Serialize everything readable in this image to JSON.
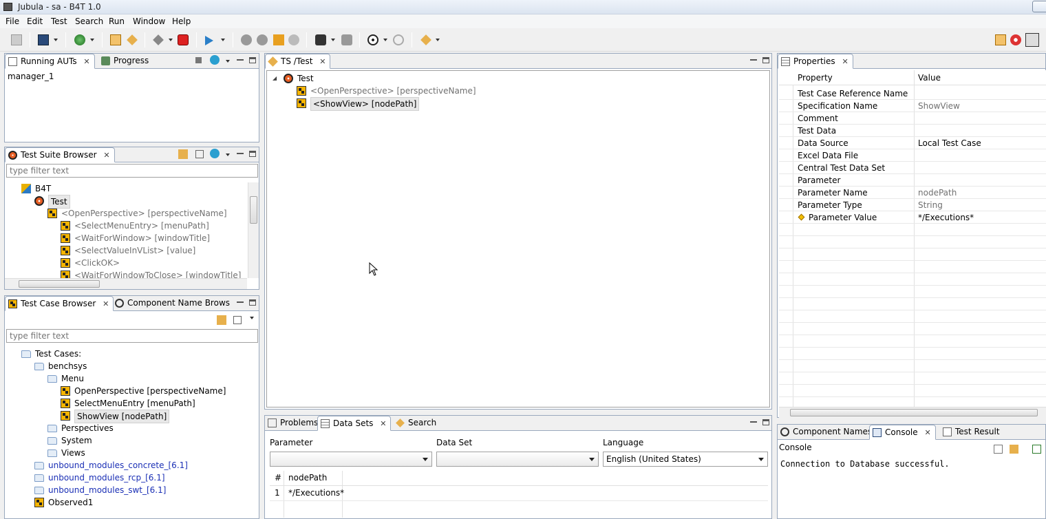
{
  "window": {
    "title": "Jubula - sa - B4T 1.0"
  },
  "menu": [
    "File",
    "Edit",
    "Test",
    "Search",
    "Run",
    "Window",
    "Help"
  ],
  "running_auts": {
    "tabs": [
      {
        "label": "Running AUTs"
      },
      {
        "label": "Progress"
      }
    ],
    "items": [
      "manager_1"
    ]
  },
  "test_suite_browser": {
    "tab": "Test Suite Browser",
    "filter_placeholder": "type filter text",
    "tree": [
      {
        "label": "B4T",
        "level": 0,
        "icon": "project-icon"
      },
      {
        "label": "Test",
        "level": 1,
        "icon": "test-suite-icon",
        "selected": true
      },
      {
        "label": "<OpenPerspective> [perspectiveName]",
        "level": 2,
        "icon": "test-case-ref-icon"
      },
      {
        "label": "<SelectMenuEntry> [menuPath]",
        "level": 3,
        "icon": "test-case-ref-icon"
      },
      {
        "label": "<WaitForWindow> [windowTitle]",
        "level": 3,
        "icon": "test-case-ref-icon"
      },
      {
        "label": "<SelectValueInVList> [value]",
        "level": 3,
        "icon": "test-case-ref-icon"
      },
      {
        "label": "<ClickOK>",
        "level": 3,
        "icon": "test-case-ref-icon"
      },
      {
        "label": "<WaitForWindowToClose> [windowTitle]",
        "level": 3,
        "icon": "test-case-ref-icon"
      }
    ]
  },
  "test_case_browser": {
    "tabs": [
      {
        "label": "Test Case Browser"
      },
      {
        "label": "Component Name Brows"
      }
    ],
    "filter_placeholder": "type filter text",
    "tree": [
      {
        "label": "Test Cases:",
        "level": 0,
        "icon": "folder-icon"
      },
      {
        "label": "benchsys",
        "level": 1,
        "icon": "folder-icon"
      },
      {
        "label": "Menu",
        "level": 2,
        "icon": "folder-icon"
      },
      {
        "label": "OpenPerspective [perspectiveName]",
        "level": 3,
        "icon": "test-case-icon"
      },
      {
        "label": "SelectMenuEntry [menuPath]",
        "level": 3,
        "icon": "test-case-icon"
      },
      {
        "label": "ShowView [nodePath]",
        "level": 3,
        "icon": "test-case-icon",
        "selected": true
      },
      {
        "label": "Perspectives",
        "level": 2,
        "icon": "folder-icon"
      },
      {
        "label": "System",
        "level": 2,
        "icon": "folder-icon"
      },
      {
        "label": "Views",
        "level": 2,
        "icon": "folder-icon"
      },
      {
        "label": "unbound_modules_concrete_[6.1]",
        "level": 1,
        "icon": "folder-icon",
        "link": true
      },
      {
        "label": "unbound_modules_rcp_[6.1]",
        "level": 1,
        "icon": "folder-icon",
        "link": true
      },
      {
        "label": "unbound_modules_swt_[6.1]",
        "level": 1,
        "icon": "folder-icon",
        "link": true
      },
      {
        "label": "Observed1",
        "level": 1,
        "icon": "test-case-icon"
      }
    ]
  },
  "editor": {
    "tab": "TS /Test",
    "tree": [
      {
        "label": "Test",
        "level": 0,
        "icon": "test-suite-icon"
      },
      {
        "label": "<OpenPerspective> [perspectiveName]",
        "level": 1,
        "icon": "test-case-ref-icon"
      },
      {
        "label": "<ShowView> [nodePath]",
        "level": 1,
        "icon": "test-case-ref-icon",
        "selected": true
      }
    ]
  },
  "properties": {
    "tab": "Properties",
    "headers": {
      "property": "Property",
      "value": "Value"
    },
    "rows": [
      {
        "property": "Test Case Reference Name",
        "value": ""
      },
      {
        "property": "Specification Name",
        "value": "ShowView",
        "gray": true
      },
      {
        "property": "Comment",
        "value": ""
      },
      {
        "property": "Test Data",
        "value": ""
      },
      {
        "property": "Data Source",
        "value": "Local Test Case"
      },
      {
        "property": "Excel Data File",
        "value": ""
      },
      {
        "property": "Central Test Data Set",
        "value": ""
      },
      {
        "property": "Parameter",
        "value": ""
      },
      {
        "property": "Parameter Name",
        "value": "nodePath",
        "gray": true
      },
      {
        "property": "Parameter Type",
        "value": "String",
        "gray": true
      },
      {
        "property": "Parameter Value",
        "value": "*/Executions*",
        "indent": true
      }
    ]
  },
  "data_sets": {
    "tabs": [
      {
        "label": "Problems"
      },
      {
        "label": "Data Sets"
      },
      {
        "label": "Search"
      }
    ],
    "labels": {
      "parameter": "Parameter",
      "data_set": "Data Set",
      "language": "Language"
    },
    "language_value": "English (United States)",
    "table_headers": [
      "#",
      "nodePath"
    ],
    "table_rows": [
      [
        "1",
        "*/Executions*"
      ]
    ]
  },
  "console": {
    "tabs": [
      {
        "label": "Component Names"
      },
      {
        "label": "Console"
      },
      {
        "label": "Test Result"
      }
    ],
    "title": "Console",
    "lines": [
      "Connection to Database successful."
    ]
  },
  "colors": {
    "accent": "#99a8bd",
    "link": "#1a2fb5",
    "test_case": "#f7b500"
  }
}
